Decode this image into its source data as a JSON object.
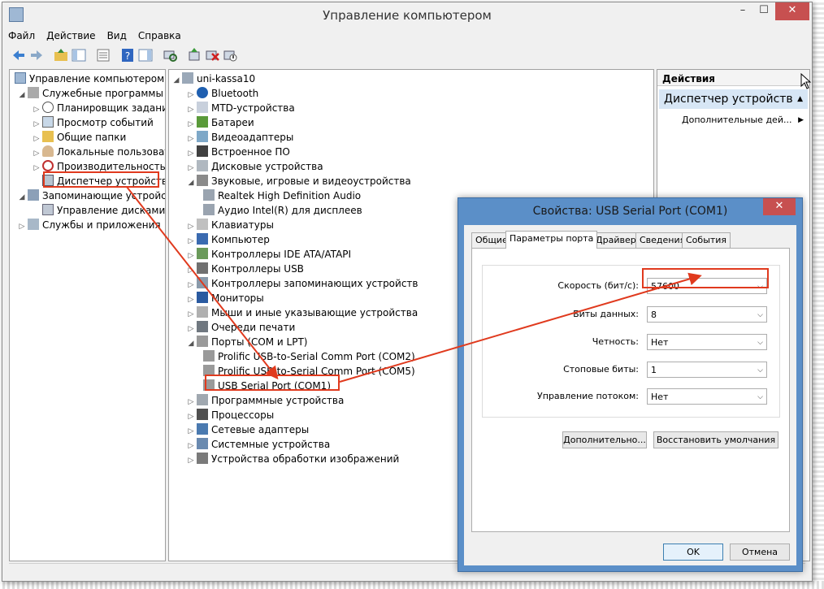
{
  "window": {
    "title": "Управление компьютером",
    "minimize": "–",
    "maximize": "☐",
    "close": "✕"
  },
  "menu": [
    "Файл",
    "Действие",
    "Вид",
    "Справка"
  ],
  "left_tree": {
    "root": "Управление компьютером (л",
    "items": [
      {
        "label": "Служебные программы",
        "icon": "tools-icon"
      },
      {
        "label": "Планировщик заданий",
        "icon": "clock-icon"
      },
      {
        "label": "Просмотр событий",
        "icon": "event-viewer-icon"
      },
      {
        "label": "Общие папки",
        "icon": "shared-folder-icon"
      },
      {
        "label": "Локальные пользовате",
        "icon": "users-icon"
      },
      {
        "label": "Производительность",
        "icon": "performance-icon"
      },
      {
        "label": "Диспетчер устройств",
        "icon": "device-manager-icon"
      },
      {
        "label": "Запоминающие устройст",
        "icon": "storage-icon"
      },
      {
        "label": "Управление дисками",
        "icon": "disk-icon"
      },
      {
        "label": "Службы и приложения",
        "icon": "services-icon"
      }
    ]
  },
  "device_tree": {
    "root": "uni-kassa10",
    "items": [
      "Bluetooth",
      "MTD-устройства",
      "Батареи",
      "Видеоадаптеры",
      "Встроенное ПО",
      "Дисковые устройства",
      "Звуковые, игровые и видеоустройства",
      "Realtek High Definition Audio",
      "Аудио Intel(R) для дисплеев",
      "Клавиатуры",
      "Компьютер",
      "Контроллеры IDE ATA/ATAPI",
      "Контроллеры USB",
      "Контроллеры запоминающих устройств",
      "Мониторы",
      "Мыши и иные указывающие устройства",
      "Очереди печати",
      "Порты (COM и LPT)",
      "Prolific USB-to-Serial Comm Port (COM2)",
      "Prolific USB-to-Serial Comm Port (COM5)",
      "USB Serial Port (COM1)",
      "Программные устройства",
      "Процессоры",
      "Сетевые адаптеры",
      "Системные устройства",
      "Устройства обработки изображений"
    ]
  },
  "actions": {
    "header": "Действия",
    "section": "Диспетчер устройств",
    "item": "Дополнительные дей..."
  },
  "dialog": {
    "title": "Свойства: USB Serial Port (COM1)",
    "close": "✕",
    "tabs": [
      "Общие",
      "Параметры порта",
      "Драйвер",
      "Сведения",
      "События"
    ],
    "fields": [
      {
        "label": "Скорость (бит/с):",
        "value": "57600"
      },
      {
        "label": "Биты данных:",
        "value": "8"
      },
      {
        "label": "Четность:",
        "value": "Нет"
      },
      {
        "label": "Стоповые биты:",
        "value": "1"
      },
      {
        "label": "Управление потоком:",
        "value": "Нет"
      }
    ],
    "advanced_button": "Дополнительно...",
    "restore_button": "Восстановить умолчания",
    "ok_button": "OK",
    "cancel_button": "Отмена"
  },
  "colors": {
    "highlight": "#e03a1e",
    "dialog_frame": "#5b8fc8",
    "close_red": "#c75050",
    "actions_section": "#d7e6f5"
  }
}
